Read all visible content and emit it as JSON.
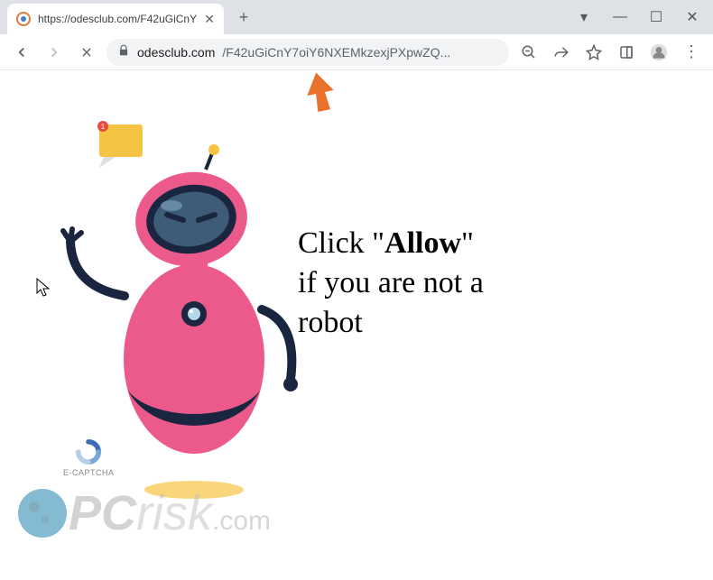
{
  "window": {
    "dropdown": "▾",
    "minimize": "—",
    "maximize": "☐",
    "close": "✕"
  },
  "tab": {
    "title": "https://odesclub.com/F42uGiCnY",
    "close": "✕"
  },
  "newtab": "+",
  "toolbar": {
    "back": "←",
    "forward": "→",
    "stop": "✕",
    "lock": "🔒",
    "domain": "odesclub.com",
    "path": "/F42uGiCnY7oiY6NXEMkzexjPXpwZQ...",
    "zoom": "⊖",
    "share": "↗",
    "star": "☆",
    "extensions": "▣",
    "profile": "👤",
    "menu": "⋮"
  },
  "message": {
    "p1a": "Click \"",
    "allow": "Allow",
    "p1b": "\" ",
    "p2": "if you are not a ",
    "p3": "robot"
  },
  "captcha": {
    "label": "E-CAPTCHA"
  },
  "watermark": {
    "pc": "PC",
    "risk": "risk",
    "com": ".com"
  }
}
